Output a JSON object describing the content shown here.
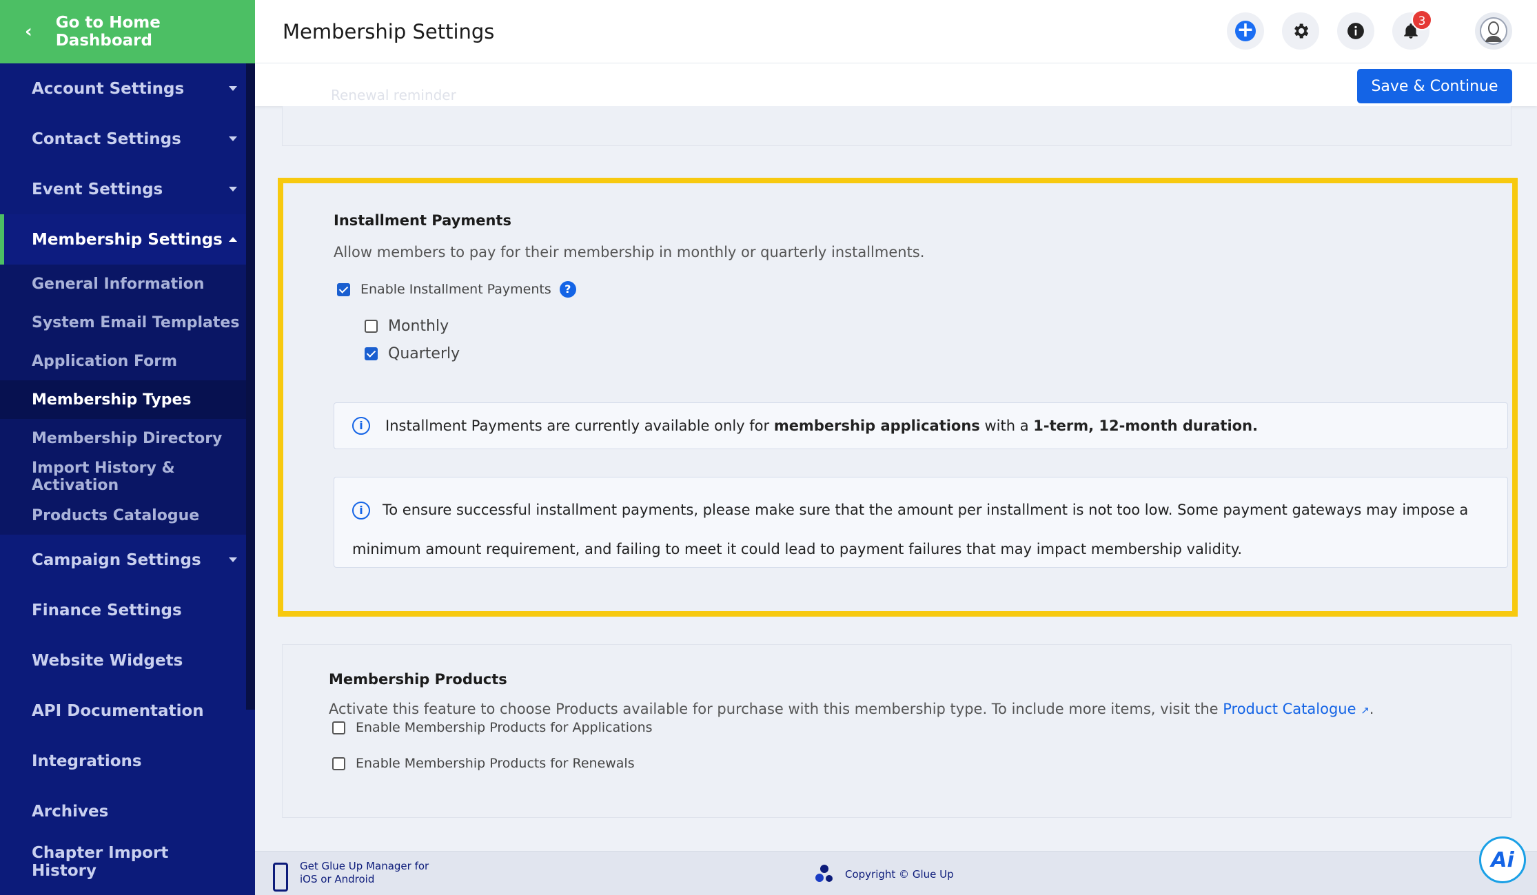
{
  "sidebar": {
    "home_label": "Go to Home Dashboard",
    "items": [
      {
        "label": "Account Settings"
      },
      {
        "label": "Contact Settings"
      },
      {
        "label": "Event Settings"
      },
      {
        "label": "Membership Settings"
      },
      {
        "label": "Campaign Settings"
      },
      {
        "label": "Finance Settings"
      },
      {
        "label": "Website Widgets"
      },
      {
        "label": "API Documentation"
      },
      {
        "label": "Integrations"
      },
      {
        "label": "Archives"
      },
      {
        "label": "Chapter Import History"
      }
    ],
    "sub_items": [
      {
        "label": "General Information"
      },
      {
        "label": "System Email Templates"
      },
      {
        "label": "Application Form"
      },
      {
        "label": "Membership Types"
      },
      {
        "label": "Membership Directory"
      },
      {
        "label": "Import History & Activation"
      },
      {
        "label": "Products Catalogue"
      }
    ]
  },
  "header": {
    "title": "Membership Settings",
    "notifications_count": "3"
  },
  "toolbar": {
    "save_label": "Save & Continue",
    "faded_text": "Renewal reminder"
  },
  "installments": {
    "title": "Installment Payments",
    "description": "Allow members to pay for their membership in monthly or quarterly installments.",
    "enable_label": "Enable Installment Payments",
    "enable_checked": true,
    "monthly_label": "Monthly",
    "monthly_checked": false,
    "quarterly_label": "Quarterly",
    "quarterly_checked": true,
    "info1_a": "Installment Payments are currently available only for ",
    "info1_b": "membership applications",
    "info1_c": " with a ",
    "info1_d": "1-term, 12-month duration.",
    "info2_line1": "To ensure successful installment payments, please make sure that the amount per installment is not too low. Some payment gateways may impose a",
    "info2_line2": "minimum amount requirement, and failing to meet it could lead to payment failures that may impact membership validity."
  },
  "products": {
    "title": "Membership Products",
    "description": "Activate this feature to choose Products available for purchase with this membership type. To include more items, visit the ",
    "link_label": "Product Catalogue",
    "desc_end": ".",
    "apps_label": "Enable Membership Products for Applications",
    "renew_label": "Enable Membership Products for Renewals"
  },
  "footer": {
    "mobile_line1": "Get Glue Up Manager for",
    "mobile_line2": "iOS or Android",
    "copyright": "Copyright © Glue Up"
  },
  "assistant": {
    "label": "Ai"
  },
  "colors": {
    "sidebar_bg": "#0c1b7a",
    "accent_green": "#4cbf64",
    "primary_blue": "#1464e6",
    "highlight_yellow": "#f7c90f",
    "badge_red": "#e53935"
  }
}
